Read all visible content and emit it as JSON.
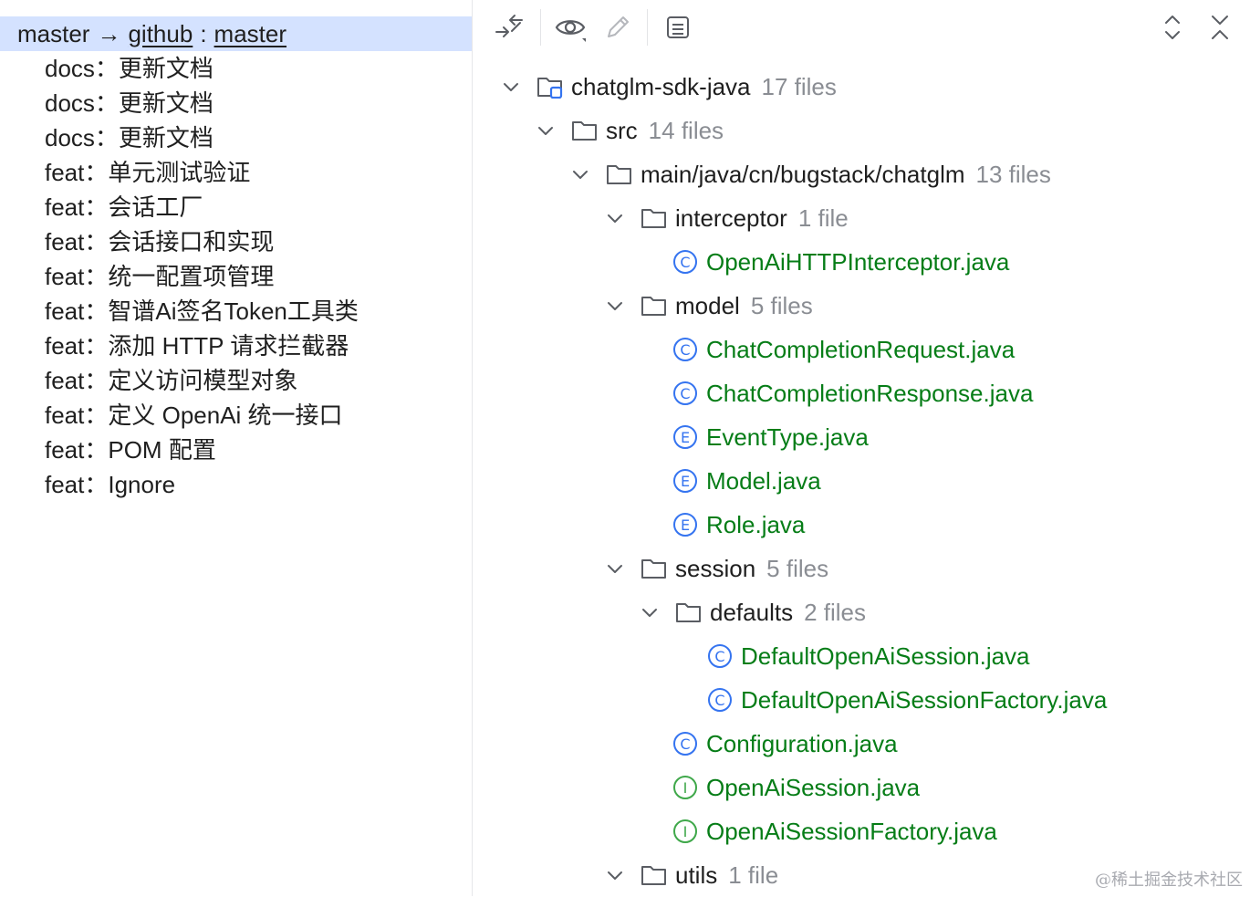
{
  "branch": {
    "local": "master",
    "arrow": "→",
    "remote": "github",
    "separator": ":",
    "remote_branch": "master"
  },
  "commits": [
    "docs：更新文档",
    "docs：更新文档",
    "docs：更新文档",
    "feat：单元测试验证",
    "feat：会话工厂",
    "feat：会话接口和实现",
    "feat：统一配置项管理",
    "feat：智谱Ai签名Token工具类",
    "feat：添加 HTTP 请求拦截器",
    "feat：定义访问模型对象",
    "feat：定义 OpenAi 统一接口",
    "feat：POM 配置",
    "feat：Ignore"
  ],
  "toolbar": {
    "icons": [
      "collapse-arrows-icon",
      "eye-icon",
      "edit-pencil-icon",
      "commit-details-icon",
      "expand-collapse-icon",
      "close-icon"
    ]
  },
  "tree": {
    "root": {
      "name": "chatglm-sdk-java",
      "count": "17 files"
    },
    "src": {
      "name": "src",
      "count": "14 files"
    },
    "main": {
      "name": "main/java/cn/bugstack/chatglm",
      "count": "13 files"
    },
    "interceptor": {
      "name": "interceptor",
      "count": "1 file"
    },
    "f_interceptor": {
      "name": "OpenAiHTTPInterceptor.java",
      "badge": "C"
    },
    "model": {
      "name": "model",
      "count": "5 files"
    },
    "f_req": {
      "name": "ChatCompletionRequest.java",
      "badge": "C"
    },
    "f_resp": {
      "name": "ChatCompletionResponse.java",
      "badge": "C"
    },
    "f_event": {
      "name": "EventType.java",
      "badge": "E"
    },
    "f_model": {
      "name": "Model.java",
      "badge": "E"
    },
    "f_role": {
      "name": "Role.java",
      "badge": "E"
    },
    "session": {
      "name": "session",
      "count": "5 files"
    },
    "defaults": {
      "name": "defaults",
      "count": "2 files"
    },
    "f_defsess": {
      "name": "DefaultOpenAiSession.java",
      "badge": "C"
    },
    "f_defsessfac": {
      "name": "DefaultOpenAiSessionFactory.java",
      "badge": "C"
    },
    "f_config": {
      "name": "Configuration.java",
      "badge": "C"
    },
    "f_sess": {
      "name": "OpenAiSession.java",
      "badge": "I"
    },
    "f_sessfac": {
      "name": "OpenAiSessionFactory.java",
      "badge": "I"
    },
    "utils": {
      "name": "utils",
      "count": "1 file"
    }
  },
  "watermark": "@稀土掘金技术社区",
  "colors": {
    "selection": "#d4e2ff",
    "file_green": "#067d17",
    "class_blue": "#3574f0",
    "interface_green": "#3fa84a",
    "count_gray": "#8a8d93"
  }
}
